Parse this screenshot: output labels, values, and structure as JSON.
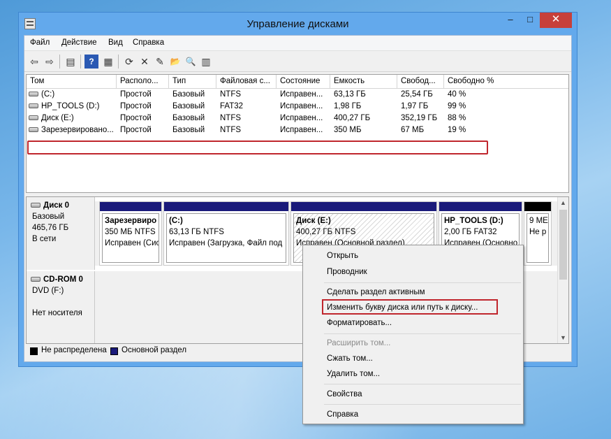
{
  "window": {
    "title": "Управление дисками",
    "minimize_glyph": "–",
    "maximize_glyph": "□",
    "close_glyph": "✕"
  },
  "menubar": [
    "Файл",
    "Действие",
    "Вид",
    "Справка"
  ],
  "toolbar": {
    "icons": [
      "back-arrow-icon",
      "forward-arrow-icon",
      "console-tree-icon",
      "help-icon",
      "properties-icon",
      "refresh-icon",
      "delete-icon",
      "settings-icon",
      "open-folder-icon",
      "search-icon",
      "table-view-icon"
    ],
    "glyphs": [
      "⇦",
      "⇨",
      "▤",
      "?",
      "▦",
      "⟳",
      "✕",
      "✎",
      "📂",
      "🔍",
      "▥"
    ]
  },
  "volume_table": {
    "columns": [
      "Том",
      "Располо...",
      "Тип",
      "Файловая с...",
      "Состояние",
      "Емкость",
      "Свобод...",
      "Свободно %"
    ],
    "rows": [
      [
        "(C:)",
        "Простой",
        "Базовый",
        "NTFS",
        "Исправен...",
        "63,13 ГБ",
        "25,54 ГБ",
        "40 %"
      ],
      [
        "HP_TOOLS (D:)",
        "Простой",
        "Базовый",
        "FAT32",
        "Исправен...",
        "1,98 ГБ",
        "1,97 ГБ",
        "99 %"
      ],
      [
        "Диск (E:)",
        "Простой",
        "Базовый",
        "NTFS",
        "Исправен...",
        "400,27 ГБ",
        "352,19 ГБ",
        "88 %"
      ],
      [
        "Зарезервировано...",
        "Простой",
        "Базовый",
        "NTFS",
        "Исправен...",
        "350 МБ",
        "67 МБ",
        "19 %"
      ]
    ]
  },
  "disks": [
    {
      "name": "Диск 0",
      "type": "Базовый",
      "size": "465,76 ГБ",
      "status": "В сети",
      "partitions": [
        {
          "name": "Зарезервиро",
          "size": "350 МБ NTFS",
          "status": "Исправен (Сис"
        },
        {
          "name": "(C:)",
          "size": "63,13 ГБ NTFS",
          "status": "Исправен (Загрузка, Файл под"
        },
        {
          "name": "Диск  (E:)",
          "size": "400,27 ГБ NTFS",
          "status": "Исправен (Основной раздел)"
        },
        {
          "name": "HP_TOOLS  (D:)",
          "size": "2,00 ГБ FAT32",
          "status": "Исправен (Основно"
        },
        {
          "name": "",
          "size": "9 МЕ",
          "status": "Не р"
        }
      ]
    },
    {
      "name": "CD-ROM 0",
      "type": "DVD (F:)",
      "size": "",
      "status": "Нет носителя"
    }
  ],
  "legend": {
    "unallocated": "Не распределена",
    "primary": "Основной раздел",
    "unallocated_color": "#000000",
    "primary_color": "#1a1a7a"
  },
  "context_menu": {
    "items": [
      {
        "label": "Открыть",
        "enabled": true
      },
      {
        "label": "Проводник",
        "enabled": true
      },
      {
        "label": "Сделать раздел активным",
        "enabled": true
      },
      {
        "label": "Изменить букву диска или путь к диску...",
        "enabled": true
      },
      {
        "label": "Форматировать...",
        "enabled": true
      },
      {
        "label": "Расширить том...",
        "enabled": false
      },
      {
        "label": "Сжать том...",
        "enabled": true
      },
      {
        "label": "Удалить том...",
        "enabled": true
      },
      {
        "label": "Свойства",
        "enabled": true
      },
      {
        "label": "Справка",
        "enabled": true
      }
    ]
  },
  "colors": {
    "title_bar": "#63a9ec",
    "close_button": "#c7403a",
    "annotation_red": "#c0262d",
    "primary_partition": "#1a1a7a"
  }
}
